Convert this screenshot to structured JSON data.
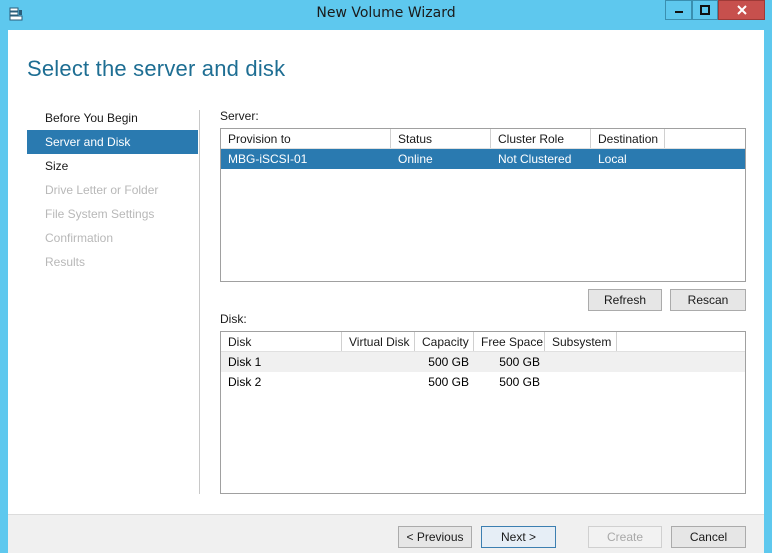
{
  "window": {
    "title": "New Volume Wizard",
    "controls": {
      "minimize": "minimize-icon",
      "maximize": "maximize-icon",
      "close": "close-icon"
    }
  },
  "heading": "Select the server and disk",
  "nav": {
    "items": [
      {
        "label": "Before You Begin",
        "state": "normal"
      },
      {
        "label": "Server and Disk",
        "state": "active"
      },
      {
        "label": "Size",
        "state": "normal"
      },
      {
        "label": "Drive Letter or Folder",
        "state": "disabled"
      },
      {
        "label": "File System Settings",
        "state": "disabled"
      },
      {
        "label": "Confirmation",
        "state": "disabled"
      },
      {
        "label": "Results",
        "state": "disabled"
      }
    ]
  },
  "server": {
    "label": "Server:",
    "columns": [
      "Provision to",
      "Status",
      "Cluster Role",
      "Destination"
    ],
    "rows": [
      {
        "provision_to": "MBG-iSCSI-01",
        "status": "Online",
        "cluster_role": "Not Clustered",
        "destination": "Local",
        "selected": true
      }
    ]
  },
  "actions": {
    "refresh": "Refresh",
    "rescan": "Rescan"
  },
  "disk": {
    "label": "Disk:",
    "columns": [
      "Disk",
      "Virtual Disk",
      "Capacity",
      "Free Space",
      "Subsystem"
    ],
    "rows": [
      {
        "disk": "Disk 1",
        "virtual_disk": "",
        "capacity": "500 GB",
        "free_space": "500 GB",
        "subsystem": ""
      },
      {
        "disk": "Disk 2",
        "virtual_disk": "",
        "capacity": "500 GB",
        "free_space": "500 GB",
        "subsystem": ""
      }
    ]
  },
  "footer": {
    "previous": "< Previous",
    "next": "Next >",
    "create": "Create",
    "cancel": "Cancel"
  },
  "colors": {
    "titlebar": "#5ec8ee",
    "heading": "#1e6e93",
    "selection": "#2a7ab0",
    "close": "#c7504d"
  }
}
